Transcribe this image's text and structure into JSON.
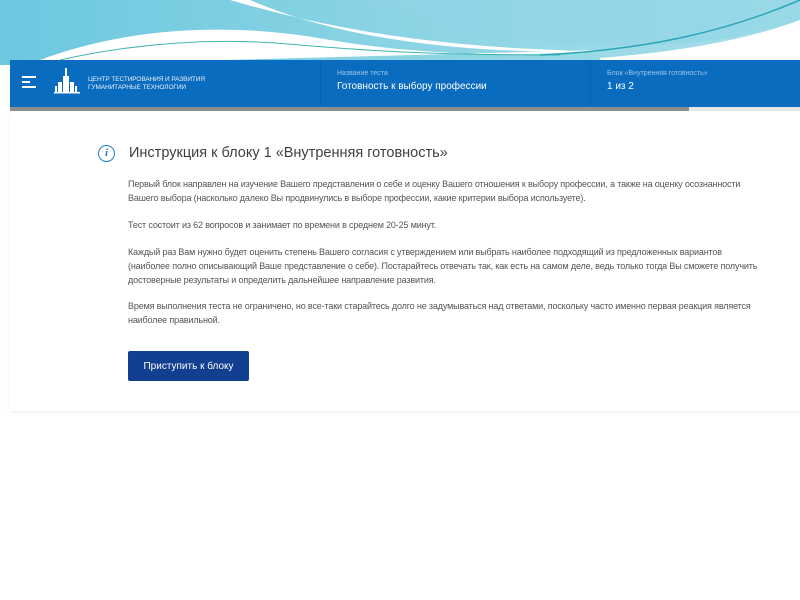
{
  "header": {
    "org_line1": "ЦЕНТР ТЕСТИРОВАНИЯ И РАЗВИТИЯ",
    "org_line2": "ГУМАНИТАРНЫЕ ТЕХНОЛОГИИ",
    "test_label": "Название теста",
    "test_name": "Готовность к выбору профессии",
    "block_label": "Блок «Внутренняя готовность»",
    "block_value": "1 из 2"
  },
  "progress": {
    "percent": 86
  },
  "instruction": {
    "title": "Инструкция к блоку 1 «Внутренняя готовность»",
    "p1": [
      "Первый блок направлен на изучение Вашего представления о себе и оценку Вашего отношения к выбору профессии, а также на оценку осознанности",
      "Вашего выбора (насколько далеко Вы продвинулись в выборе профессии, какие критерии выбора используете)."
    ],
    "p2": [
      "Тест состоит из 62 вопросов и занимает по времени в среднем 20-25 минут."
    ],
    "p3": [
      "Каждый раз Вам нужно будет оценить степень Вашего согласия с утверждением или выбрать наиболее подходящий из предложенных вариантов",
      "(наиболее полно описывающий Ваше представление о себе). Постарайтесь отвечать так, как есть на самом деле, ведь только тогда Вы сможете получить",
      "достоверные результаты и определить дальнейшее направление развития."
    ],
    "p4": [
      "Время выполнения теста не ограничено, но все-таки старайтесь долго не задумываться над ответами, поскольку часто именно первая реакция является",
      "наиболее правильной."
    ],
    "start_button": "Приступить к блоку"
  }
}
